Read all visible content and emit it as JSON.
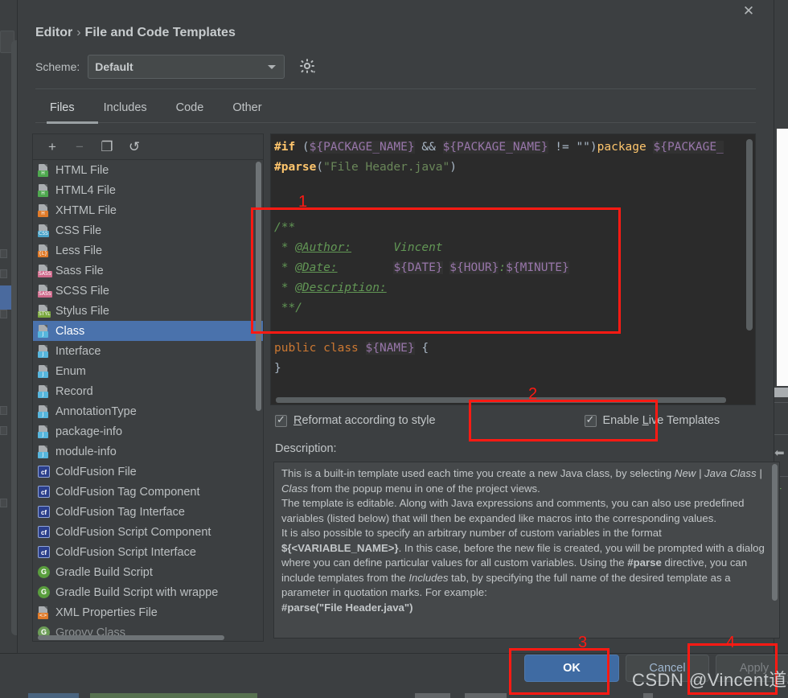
{
  "window": {
    "close_icon": "close-icon"
  },
  "breadcrumb": {
    "parent": "Editor",
    "separator": "›",
    "current": "File and Code Templates"
  },
  "scheme": {
    "label": "Scheme:",
    "value": "Default",
    "gear_icon": "gear-icon",
    "caret_icon": "chevron-down-icon"
  },
  "tabs": [
    {
      "label": "Files",
      "active": true
    },
    {
      "label": "Includes",
      "active": false
    },
    {
      "label": "Code",
      "active": false
    },
    {
      "label": "Other",
      "active": false
    }
  ],
  "list_toolbar": [
    {
      "name": "add-template-button",
      "glyph": "+",
      "enabled": true
    },
    {
      "name": "remove-template-button",
      "glyph": "−",
      "enabled": false
    },
    {
      "name": "copy-template-button",
      "glyph": "❐",
      "enabled": true
    },
    {
      "name": "reset-template-button",
      "glyph": "↺",
      "enabled": true
    }
  ],
  "templates": [
    {
      "label": "HTML File",
      "icon": "html-file-icon",
      "badge": "H",
      "badge_color": "#4fa84f",
      "selected": false
    },
    {
      "label": "HTML4 File",
      "icon": "html4-file-icon",
      "badge": "H",
      "badge_color": "#4fa84f",
      "selected": false
    },
    {
      "label": "XHTML File",
      "icon": "xhtml-file-icon",
      "badge": "H",
      "badge_color": "#e07b2a",
      "selected": false
    },
    {
      "label": "CSS File",
      "icon": "css-file-icon",
      "badge": "CSS",
      "badge_color": "#4aa3c8",
      "selected": false
    },
    {
      "label": "Less File",
      "icon": "less-file-icon",
      "badge": "{L}",
      "badge_color": "#e07b2a",
      "selected": false
    },
    {
      "label": "Sass File",
      "icon": "sass-file-icon",
      "badge": "SASS",
      "badge_color": "#cf6a8c",
      "selected": false
    },
    {
      "label": "SCSS File",
      "icon": "scss-file-icon",
      "badge": "SASS",
      "badge_color": "#cf6a8c",
      "selected": false
    },
    {
      "label": "Stylus File",
      "icon": "stylus-file-icon",
      "badge": "STYL",
      "badge_color": "#7ba93f",
      "selected": false
    },
    {
      "label": "Class",
      "icon": "java-class-icon",
      "badge": "J",
      "badge_color": "#57b6dd",
      "selected": true
    },
    {
      "label": "Interface",
      "icon": "java-interface-icon",
      "badge": "J",
      "badge_color": "#57b6dd",
      "selected": false
    },
    {
      "label": "Enum",
      "icon": "java-enum-icon",
      "badge": "J",
      "badge_color": "#57b6dd",
      "selected": false
    },
    {
      "label": "Record",
      "icon": "java-record-icon",
      "badge": "J",
      "badge_color": "#57b6dd",
      "selected": false
    },
    {
      "label": "AnnotationType",
      "icon": "java-annotation-icon",
      "badge": "J",
      "badge_color": "#57b6dd",
      "selected": false
    },
    {
      "label": "package-info",
      "icon": "java-package-info-icon",
      "badge": "J",
      "badge_color": "#57b6dd",
      "selected": false
    },
    {
      "label": "module-info",
      "icon": "java-module-info-icon",
      "badge": "J",
      "badge_color": "#57b6dd",
      "selected": false
    },
    {
      "label": "ColdFusion File",
      "icon": "coldfusion-icon",
      "badge": "cf",
      "badge_color": "#2b3f8c",
      "square": true,
      "selected": false
    },
    {
      "label": "ColdFusion Tag Component",
      "icon": "coldfusion-icon",
      "badge": "cf",
      "badge_color": "#2b3f8c",
      "square": true,
      "selected": false
    },
    {
      "label": "ColdFusion Tag Interface",
      "icon": "coldfusion-icon",
      "badge": "cf",
      "badge_color": "#2b3f8c",
      "square": true,
      "selected": false
    },
    {
      "label": "ColdFusion Script Component",
      "icon": "coldfusion-icon",
      "badge": "cf",
      "badge_color": "#2b3f8c",
      "square": true,
      "selected": false
    },
    {
      "label": "ColdFusion Script Interface",
      "icon": "coldfusion-icon",
      "badge": "cf",
      "badge_color": "#2b3f8c",
      "square": true,
      "selected": false
    },
    {
      "label": "Gradle Build Script",
      "icon": "gradle-icon",
      "badge": "G",
      "badge_color": "#5a9e3e",
      "circle": true,
      "selected": false
    },
    {
      "label": "Gradle Build Script with wrappe",
      "icon": "gradle-icon",
      "badge": "G",
      "badge_color": "#5a9e3e",
      "circle": true,
      "selected": false
    },
    {
      "label": "XML Properties File",
      "icon": "xml-properties-icon",
      "badge": "<>",
      "badge_color": "#e07b2a",
      "selected": false
    },
    {
      "label": "Groovy Class",
      "icon": "groovy-icon",
      "badge": "G",
      "badge_color": "#6c9d57",
      "circle": true,
      "selected": false,
      "dim": true
    }
  ],
  "editor": {
    "lines": [
      "#if (${PACKAGE_NAME} && ${PACKAGE_NAME} != \"\")package ${PACKAGE_",
      "#parse(\"File Header.java\")",
      "",
      "",
      "/**",
      " * @Author:      Vincent",
      " * @Date:        ${DATE} ${HOUR}:${MINUTE}",
      " * @Description:",
      " **/",
      "",
      "public class ${NAME} {",
      "}"
    ],
    "author_value": "Vincent",
    "date_value": "${DATE} ${HOUR}:${MINUTE}"
  },
  "options": {
    "reformat": {
      "label_pre": "R",
      "label_rest": "eformat according to style",
      "checked": true
    },
    "live_templates": {
      "label_pre": "Enable ",
      "label_mnemonic": "L",
      "label_rest": "ive Templates",
      "checked": true
    }
  },
  "description": {
    "label": "Description:",
    "paragraphs": [
      "This is a built-in template used each time you create a new Java class, by selecting New | Java Class | Class from the popup menu in one of the project views.",
      "The template is editable. Along with Java expressions and comments, you can also use predefined variables (listed below) that will then be expanded like macros into the corresponding values.",
      "It is also possible to specify an arbitrary number of custom variables in the format ${<VARIABLE_NAME>}. In this case, before the new file is created, you will be prompted with a dialog where you can define particular values for all custom variables. Using the #parse directive, you can include templates from the Includes tab, by specifying the full name of the desired template as a parameter in quotation marks. For example:",
      "#parse(\"File Header.java\")"
    ]
  },
  "buttons": {
    "ok": "OK",
    "cancel": "Cancel",
    "apply": "Apply"
  },
  "annotations": [
    {
      "number": "1",
      "target": "javadoc-block"
    },
    {
      "number": "2",
      "target": "enable-live-templates-checkbox"
    },
    {
      "number": "3",
      "target": "ok-button"
    },
    {
      "number": "4",
      "target": "apply-button"
    }
  ],
  "watermark": "CSDN @Vincent道格",
  "colors": {
    "accent_blue": "#4a72ac",
    "annotation_red": "#ff1a13",
    "dialog_bg": "#3c3f41",
    "editor_bg": "#2b2b2b",
    "ok_button": "#3f6ba3"
  }
}
